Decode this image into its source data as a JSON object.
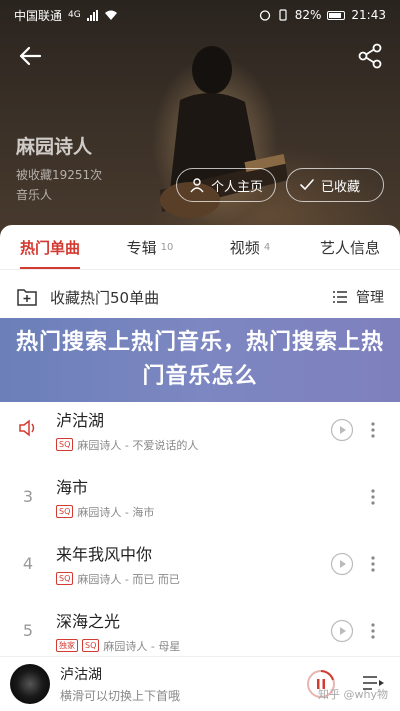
{
  "statusbar": {
    "carrier": "中国联通",
    "network": "4G",
    "battery": "82%",
    "time": "21:43"
  },
  "header": {
    "artist_name": "麻园诗人",
    "fav_count": "被收藏19251次",
    "artist_type": "音乐人",
    "home_button": "个人主页",
    "fav_button": "已收藏"
  },
  "tabs": [
    {
      "label": "热门单曲",
      "count": ""
    },
    {
      "label": "专辑",
      "count": "10"
    },
    {
      "label": "视频",
      "count": "4"
    },
    {
      "label": "艺人信息",
      "count": ""
    }
  ],
  "collect": {
    "label": "收藏热门50单曲",
    "manage": "管理"
  },
  "banner": {
    "text": "热门搜索上热门音乐，热门搜索上热门音乐怎么"
  },
  "songs": [
    {
      "index": "",
      "title": "泸沽湖",
      "badge": "SQ",
      "meta": "麻园诗人 - 不爱说话的人",
      "playing": true
    },
    {
      "index": "3",
      "title": "海市",
      "badge": "SQ",
      "meta": "麻园诗人 - 海市"
    },
    {
      "index": "4",
      "title": "来年我风中你",
      "badge": "SQ",
      "meta": "麻园诗人 - 而已 而已"
    },
    {
      "index": "5",
      "title": "深海之光",
      "badge": "独家",
      "badge2": "SQ",
      "meta": "麻园诗人 - 母星"
    }
  ],
  "player": {
    "title": "泸沽湖",
    "hint": "横滑可以切换上下首哦"
  },
  "watermark": "知乎 @why物",
  "colors": {
    "accent": "#d33a31",
    "banner": "#7a84be"
  }
}
